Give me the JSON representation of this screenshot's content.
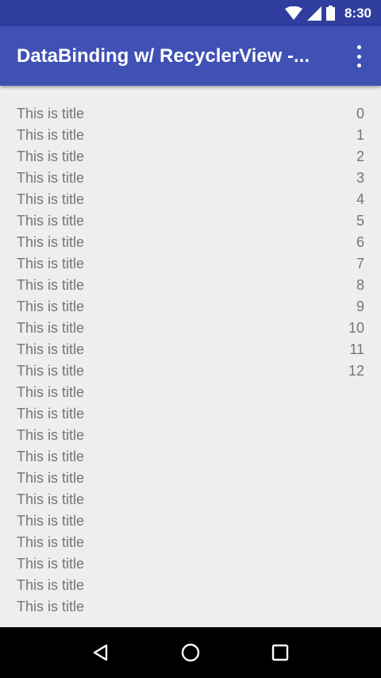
{
  "status_bar": {
    "time": "8:30",
    "icons": [
      "wifi-icon",
      "signal-icon",
      "battery-icon"
    ]
  },
  "app_bar": {
    "title": "DataBinding w/ RecyclerView -...",
    "overflow_icon": "more-vert-icon",
    "color": "#3f51b5"
  },
  "list": {
    "items": [
      {
        "title": "This is title",
        "value": "0"
      },
      {
        "title": "This is title",
        "value": "1"
      },
      {
        "title": "This is title",
        "value": "2"
      },
      {
        "title": "This is title",
        "value": "3"
      },
      {
        "title": "This is title",
        "value": "4"
      },
      {
        "title": "This is title",
        "value": "5"
      },
      {
        "title": "This is title",
        "value": "6"
      },
      {
        "title": "This is title",
        "value": "7"
      },
      {
        "title": "This is title",
        "value": "8"
      },
      {
        "title": "This is title",
        "value": "9"
      },
      {
        "title": "This is title",
        "value": "10"
      },
      {
        "title": "This is title",
        "value": "11"
      },
      {
        "title": "This is title",
        "value": "12"
      },
      {
        "title": "This is title",
        "value": ""
      },
      {
        "title": "This is title",
        "value": ""
      },
      {
        "title": "This is title",
        "value": ""
      },
      {
        "title": "This is title",
        "value": ""
      },
      {
        "title": "This is title",
        "value": ""
      },
      {
        "title": "This is title",
        "value": ""
      },
      {
        "title": "This is title",
        "value": ""
      },
      {
        "title": "This is title",
        "value": ""
      },
      {
        "title": "This is title",
        "value": ""
      },
      {
        "title": "This is title",
        "value": ""
      },
      {
        "title": "This is title",
        "value": ""
      },
      {
        "title": "This is title",
        "value": ""
      }
    ]
  },
  "nav_bar": {
    "buttons": [
      "back-icon",
      "home-icon",
      "recents-icon"
    ]
  }
}
